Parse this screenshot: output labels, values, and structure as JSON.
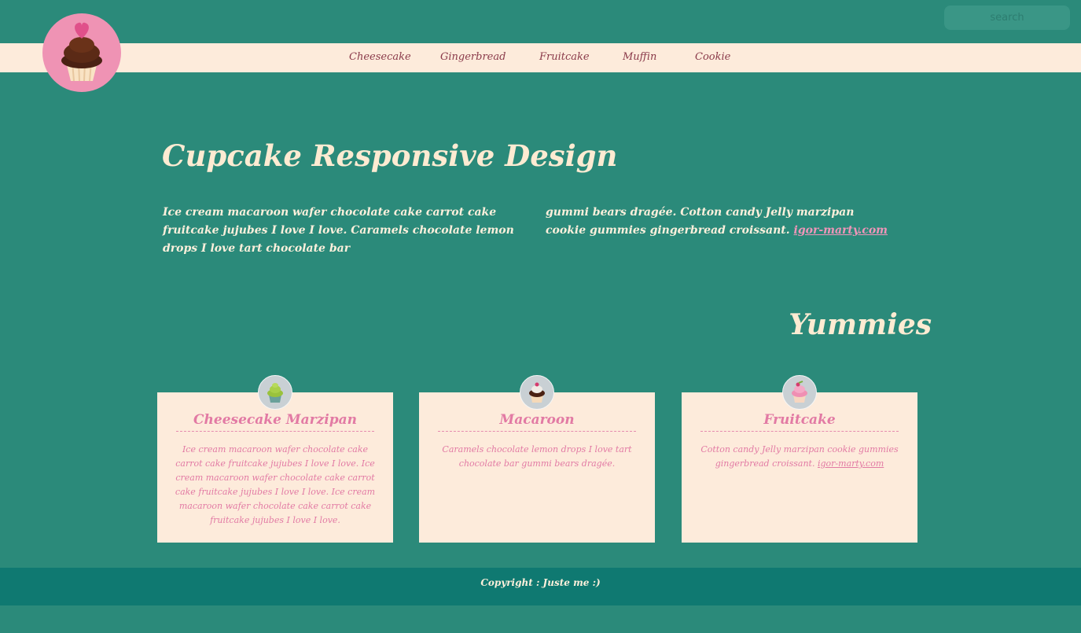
{
  "header": {
    "search_placeholder": "search",
    "logo_icon": "cupcake-icon"
  },
  "nav": {
    "items": [
      {
        "label": "Cheesecake"
      },
      {
        "label": "Gingerbread"
      },
      {
        "label": "Fruitcake"
      },
      {
        "label": "Muffin"
      },
      {
        "label": "Cookie"
      }
    ]
  },
  "main": {
    "title": "Cupcake Responsive Design",
    "intro_col1": "Ice cream macaroon wafer chocolate cake carrot cake fruitcake jujubes I love I love. Caramels chocolate lemon drops I love tart chocolate bar",
    "intro_col2": "gummi bears dragée. Cotton candy Jelly marzipan cookie gummies gingerbread croissant.",
    "intro_link": "igor-marty.com"
  },
  "yummies": {
    "title": "Yummies",
    "cards": [
      {
        "title": "Cheesecake Marzipan",
        "text": "Ice cream macaroon wafer chocolate cake carrot cake fruitcake jujubes I love I love. Ice cream macaroon wafer chocolate cake carrot cake fruitcake jujubes I love I love. Ice cream macaroon wafer chocolate cake carrot cake fruitcake jujubes I love I love.",
        "icon": "green-cupcake-icon"
      },
      {
        "title": "Macaroon",
        "text": "Caramels chocolate lemon drops I love tart chocolate bar gummi bears dragée.",
        "icon": "chocolate-cupcake-icon"
      },
      {
        "title": "Fruitcake",
        "text": "Cotton candy Jelly marzipan cookie gummies gingerbread croissant.",
        "link": "igor-marty.com",
        "icon": "pink-cupcake-icon"
      }
    ]
  },
  "footer": {
    "copyright": "Copyright : Juste me :)"
  },
  "colors": {
    "background": "#2b8a7a",
    "nav_bg": "#fdebdb",
    "accent_pink": "#e27aa4",
    "footer_bg": "#0f7971",
    "title_cream": "#fdebd2"
  }
}
